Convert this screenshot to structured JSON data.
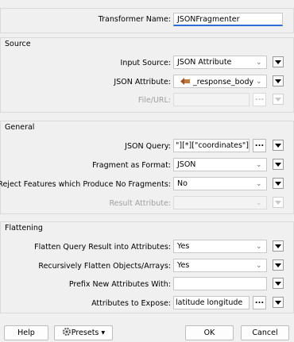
{
  "transformer": {
    "label": "Transformer Name:",
    "value": "JSONFragmenter"
  },
  "source": {
    "title": "Source",
    "input_source": {
      "label": "Input Source:",
      "value": "JSON Attribute"
    },
    "json_attribute": {
      "label": "JSON Attribute:",
      "value": "_response_body"
    },
    "file_url": {
      "label": "File/URL:",
      "value": ""
    }
  },
  "general": {
    "title": "General",
    "json_query": {
      "label": "JSON Query:",
      "value": "\"][*][\"coordinates\"]"
    },
    "fragment_format": {
      "label": "Fragment as Format:",
      "value": "JSON"
    },
    "reject": {
      "label": "Reject Features which Produce No Fragments:",
      "value": "No"
    },
    "result_attribute": {
      "label": "Result Attribute:",
      "value": ""
    }
  },
  "flattening": {
    "title": "Flattening",
    "flatten_query": {
      "label": "Flatten Query Result into Attributes:",
      "value": "Yes"
    },
    "recursive": {
      "label": "Recursively Flatten Objects/Arrays:",
      "value": "Yes"
    },
    "prefix": {
      "label": "Prefix New Attributes With:",
      "value": ""
    },
    "expose": {
      "label": "Attributes to Expose:",
      "value": "latitude longitude"
    }
  },
  "footer": {
    "help": "Help",
    "presets": "Presets",
    "ok": "OK",
    "cancel": "Cancel"
  },
  "glyphs": {
    "dots": "...",
    "caret": "⌄",
    "caret_down": "▾"
  }
}
